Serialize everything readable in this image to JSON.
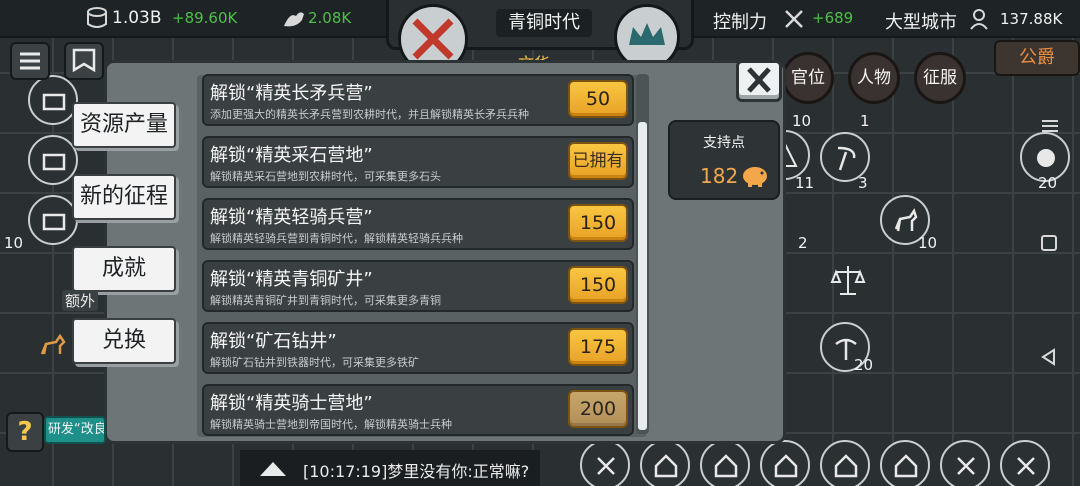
{
  "topbar": {
    "gold": "1.03B",
    "gold_rate": "+89.60K",
    "strength": "2.08K",
    "era": "青铜时代",
    "era_sub": "文华",
    "control_label": "控制力",
    "control_rate": "+689",
    "city_type": "大型城市",
    "population": "137.88K",
    "rank_button": "公爵"
  },
  "circle_menu": {
    "office": "官位",
    "people": "人物",
    "expedition": "征服"
  },
  "side_tabs": [
    "资源产量",
    "新的征程",
    "成就",
    "兑换"
  ],
  "unlocks": [
    {
      "title": "解锁“精英长矛兵营”",
      "desc": "添加更强大的精英长矛兵营到农耕时代，并且解锁精英长矛兵兵种",
      "cost": "50"
    },
    {
      "title": "解锁“精英采石营地”",
      "desc": "解锁精英采石营地到农耕时代，可采集更多石头",
      "cost": "已拥有"
    },
    {
      "title": "解锁“精英轻骑兵营”",
      "desc": "解锁精英轻骑兵营到青铜时代，解锁精英轻骑兵兵种",
      "cost": "150"
    },
    {
      "title": "解锁“精英青铜矿井”",
      "desc": "解锁精英青铜矿井到青铜时代，可采集更多青铜",
      "cost": "150"
    },
    {
      "title": "解锁“矿石钻井”",
      "desc": "解锁矿石钻井到铁器时代，可采集更多铁矿",
      "cost": "175"
    },
    {
      "title": "解锁“精英骑士营地”",
      "desc": "解锁精英骑士营地到帝国时代，解锁精英骑士兵种",
      "cost": "200"
    }
  ],
  "support": {
    "label": "支持点",
    "value": "182"
  },
  "log": {
    "text": "[10:17:19]梦里没有你:正常嘛?"
  },
  "help_label": "?",
  "research_label": "研发“改良",
  "extra_label": "额外",
  "board_numbers": [
    "10",
    "1",
    "11",
    "3",
    "20",
    "2",
    "10",
    "10",
    "20",
    "10"
  ],
  "colors": {
    "accent": "#f4a64b",
    "cost_button": "#f9c640",
    "green": "#4fbf4a",
    "research": "#1f8f8a"
  }
}
